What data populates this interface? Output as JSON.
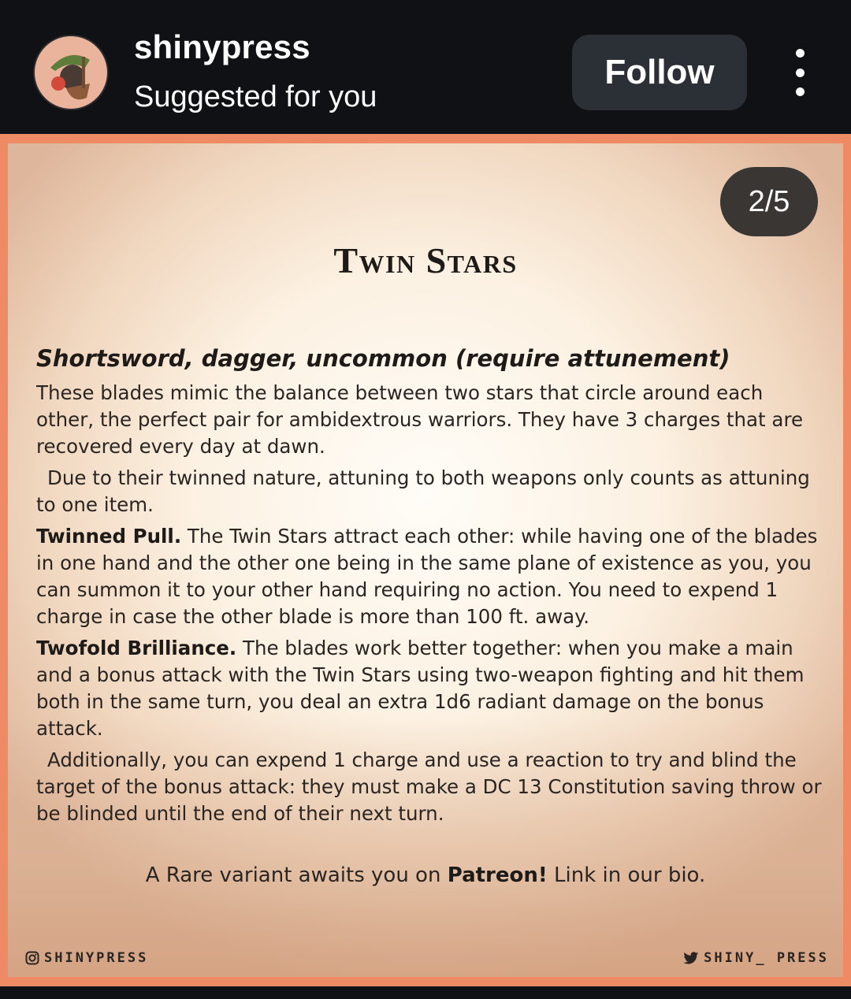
{
  "header": {
    "username": "shinypress",
    "subtitle": "Suggested for you",
    "follow_label": "Follow"
  },
  "post": {
    "page_counter": "2/5",
    "title": "Twin Stars",
    "item_type": "Shortsword, dagger, uncommon (require attunement)",
    "paragraphs": {
      "intro": "These blades mimic the balance between two stars that circle around each other, the perfect pair for ambidextrous warriors. They have 3 charges that are recovered every day at dawn.",
      "attune": "Due to their twinned nature, attuning to both weapons only counts as attuning to one item.",
      "pull_term": "Twinned Pull.",
      "pull_text": " The Twin Stars attract each other: while having one of the blades in one hand and the other one being in the same plane of existence as you, you can summon it to your other hand requiring no action. You need to expend 1 charge in case the other blade is more than 100 ft. away.",
      "brilliance_term": "Twofold Brilliance.",
      "brilliance_text": " The blades work better together: when you make a main and a bonus attack with the Twin Stars using two-weapon fighting and hit them both in the same turn, you deal an extra 1d6 radiant damage on the bonus attack.",
      "additional": "Additionally, you can expend 1 charge and use a reaction to try and blind the target of the bonus attack: they must make a DC 13 Constitution saving throw or be blinded until the end of their next turn."
    },
    "patreon": {
      "prefix": "A Rare variant awaits you on ",
      "brand": "Patreon!",
      "suffix": " Link in our bio."
    },
    "footer_left": "SHINYPRESS",
    "footer_right": "SHINY_ PRESS"
  },
  "colors": {
    "header_bg": "#0f1115",
    "follow_bg": "#2b2f36",
    "card_border": "#ee8a64",
    "parchment": "#fcf1e2",
    "counter_bg": "#3a3633"
  },
  "icons": {
    "more": "more-vertical-icon",
    "instagram": "instagram-icon",
    "twitter": "twitter-bird-icon"
  }
}
